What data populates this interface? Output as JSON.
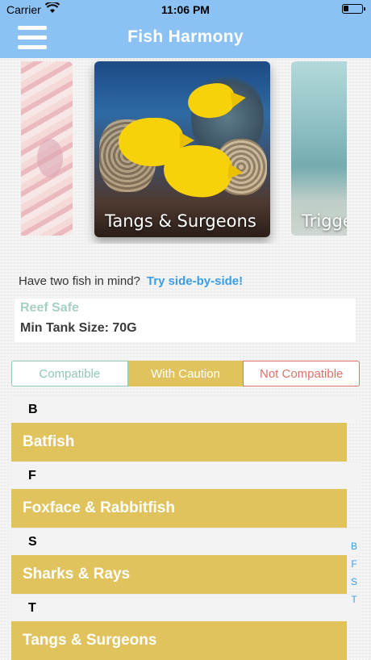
{
  "status_bar": {
    "carrier": "Carrier",
    "time": "11:06 PM"
  },
  "nav": {
    "title": "Fish Harmony"
  },
  "carousel": {
    "center_label": "Tangs & Surgeons",
    "right_label": "Trigge"
  },
  "compare": {
    "prompt": "Have two fish in mind?",
    "link": "Try side-by-side!"
  },
  "info": {
    "reef_safe": "Reef Safe",
    "min_tank": "Min Tank Size: 70G"
  },
  "segments": {
    "compatible": "Compatible",
    "caution": "With Caution",
    "not_compatible": "Not Compatible",
    "selected": "With Caution"
  },
  "list": {
    "sections": [
      {
        "letter": "B",
        "items": [
          "Batfish"
        ]
      },
      {
        "letter": "F",
        "items": [
          "Foxface & Rabbitfish"
        ]
      },
      {
        "letter": "S",
        "items": [
          "Sharks & Rays"
        ]
      },
      {
        "letter": "T",
        "items": [
          "Tangs & Surgeons"
        ]
      }
    ]
  },
  "index": [
    "B",
    "F",
    "S",
    "T"
  ],
  "colors": {
    "nav_blue": "#8cc2f3",
    "caution_yellow": "#e1c35d",
    "compatible_green": "#90c8b8",
    "incompatible_red": "#e17167",
    "link_blue": "#3b9de7"
  }
}
